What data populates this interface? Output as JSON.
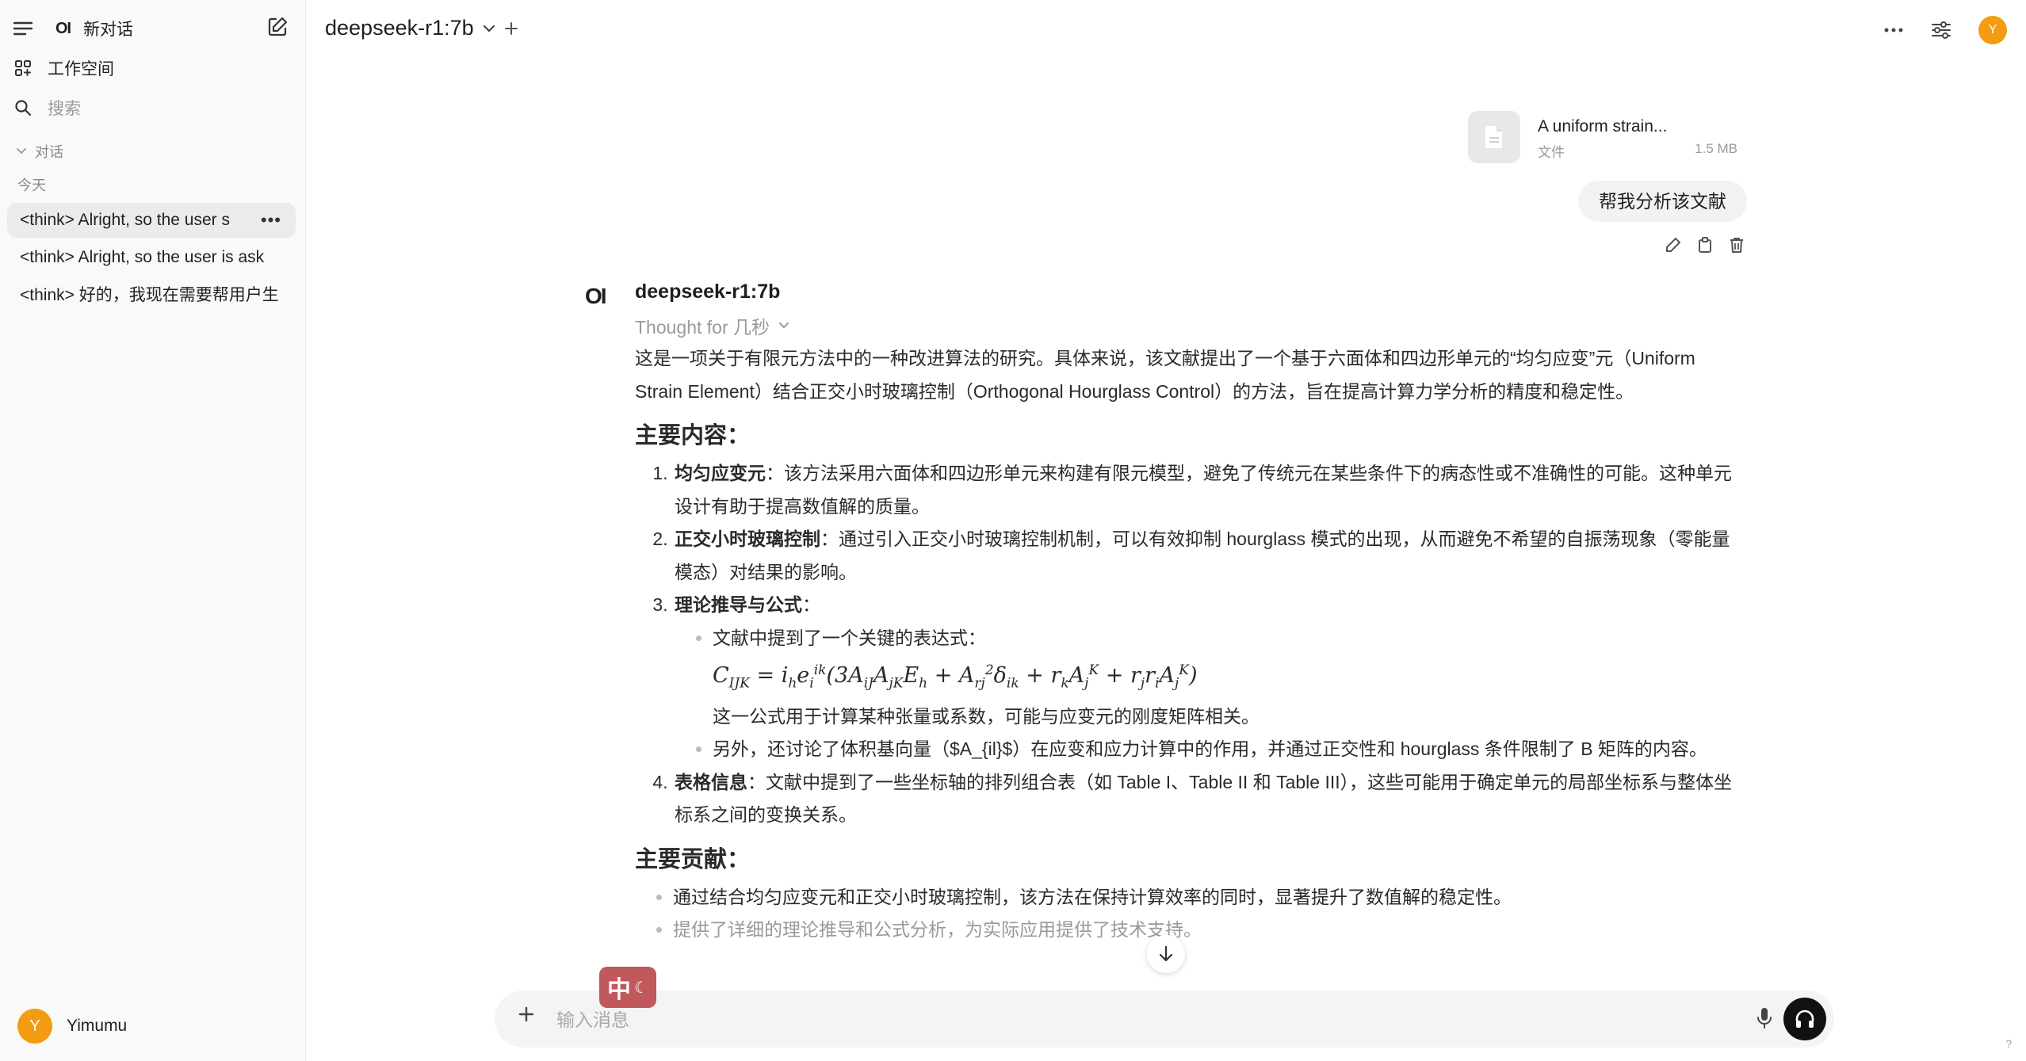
{
  "sidebar": {
    "brand_logo": "OI",
    "new_chat": "新对话",
    "workspace": "工作空间",
    "search_placeholder": "搜索",
    "section_label": "对话",
    "today_label": "今天",
    "chats": [
      {
        "title": "<think> Alright, so the user s",
        "active": true
      },
      {
        "title": "<think> Alright, so the user is ask"
      },
      {
        "title": "<think> 好的，我现在需要帮用户生"
      }
    ],
    "user": {
      "initial": "Y",
      "name": "Yimumu"
    }
  },
  "header": {
    "model": "deepseek-r1:7b",
    "avatar_initial": "Y"
  },
  "file": {
    "name": "A uniform strain...",
    "type": "文件",
    "size": "1.5 MB"
  },
  "user_message": "帮我分析该文献",
  "assistant": {
    "logo": "OI",
    "name": "deepseek-r1:7b",
    "thought": "Thought for 几秒",
    "intro": "这是一项关于有限元方法中的一种改进算法的研究。具体来说，该文献提出了一个基于六面体和四边形单元的“均匀应变”元（Uniform Strain Element）结合正交小时玻璃控制（Orthogonal Hourglass Control）的方法，旨在提高计算力学分析的精度和稳定性。",
    "h_main": "主要内容：",
    "items": [
      {
        "title": "均匀应变元",
        "text": "：该方法采用六面体和四边形单元来构建有限元模型，避免了传统元在某些条件下的病态性或不准确性的可能。这种单元设计有助于提高数值解的质量。"
      },
      {
        "title": "正交小时玻璃控制",
        "text": "：通过引入正交小时玻璃控制机制，可以有效抑制 hourglass 模式的出现，从而避免不希望的自振荡现象（零能量模态）对结果的影响。"
      },
      {
        "title": "理论推导与公式",
        "text": "："
      },
      {
        "title": "表格信息",
        "text": "：文献中提到了一些坐标轴的排列组合表（如 Table I、Table II 和 Table III），这些可能用于确定单元的局部坐标系与整体坐标系之间的变换关系。"
      }
    ],
    "sub_bullet_1": "文献中提到了一个关键的表达式：",
    "sub_bullet_1_after": "这一公式用于计算某种张量或系数，可能与应变元的刚度矩阵相关。",
    "sub_bullet_2": "另外，还讨论了体积基向量（$A_{il}$）在应变和应力计算中的作用，并通过正交性和 hourglass 条件限制了 B 矩阵的内容。",
    "h_contrib": "主要贡献：",
    "contrib_1": "通过结合均匀应变元和正交小时玻璃控制，该方法在保持计算效率的同时，显著提升了数值解的稳定性。",
    "contrib_2": "提供了详细的理论推导和公式分析，为实际应用提供了技术支持。"
  },
  "composer": {
    "placeholder": "输入消息",
    "ime_label": "中"
  },
  "help": "?"
}
